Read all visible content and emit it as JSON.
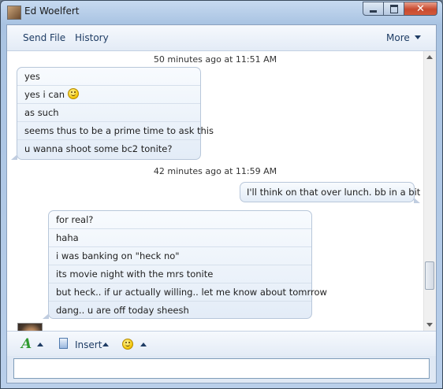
{
  "window": {
    "title": "Ed Woelfert"
  },
  "toolbar": {
    "send_file": "Send File",
    "history": "History",
    "more": "More"
  },
  "conversation": {
    "timestamp_1": "50 minutes ago at 11:51 AM",
    "group_1": [
      "yes",
      "yes i can",
      "as such",
      "seems thus to be a prime time to ask this",
      "u wanna shoot some bc2 tonite?"
    ],
    "timestamp_2": "42 minutes ago at 11:59 AM",
    "self_message": "I'll think on that over lunch. bb in a bit",
    "group_2": [
      "for real?",
      "haha",
      "i was banking on \"heck no\"",
      "its movie night with the mrs tonite",
      "but heck.. if ur actually willing.. let me know about tomrrow",
      "dang.. u are off today sheesh"
    ]
  },
  "compose": {
    "insert": "Insert",
    "input_value": ""
  },
  "icons": {
    "font": "font-color-icon",
    "insert": "document-icon",
    "emoticon": "smiley-icon"
  }
}
